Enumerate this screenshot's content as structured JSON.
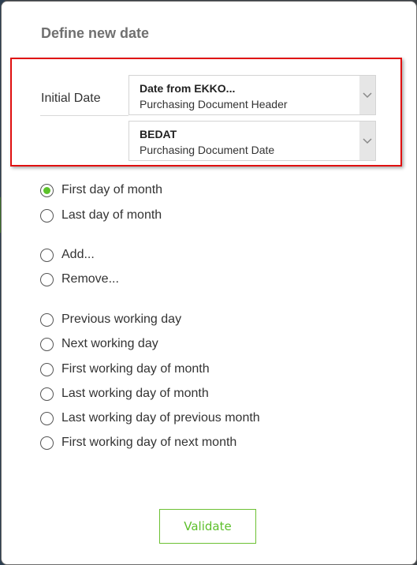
{
  "dialog": {
    "title": "Define new date",
    "initial_date_label": "Initial Date",
    "source_select": {
      "title": "Date from EKKO...",
      "subtitle": "Purchasing Document Header"
    },
    "field_select": {
      "title": "BEDAT",
      "subtitle": "Purchasing Document Date"
    },
    "options": [
      {
        "label": "First day of month",
        "checked": true
      },
      {
        "label": "Last day of month",
        "checked": false
      },
      {
        "label": "Add...",
        "checked": false
      },
      {
        "label": "Remove...",
        "checked": false
      },
      {
        "label": "Previous working day",
        "checked": false
      },
      {
        "label": "Next working day",
        "checked": false
      },
      {
        "label": "First working day of month",
        "checked": false
      },
      {
        "label": "Last working day of month",
        "checked": false
      },
      {
        "label": "Last working day of previous month",
        "checked": false
      },
      {
        "label": "First working day of next month",
        "checked": false
      }
    ],
    "validate_label": "Validate",
    "colors": {
      "accent": "#5cc22a",
      "highlight": "#e01010"
    }
  }
}
